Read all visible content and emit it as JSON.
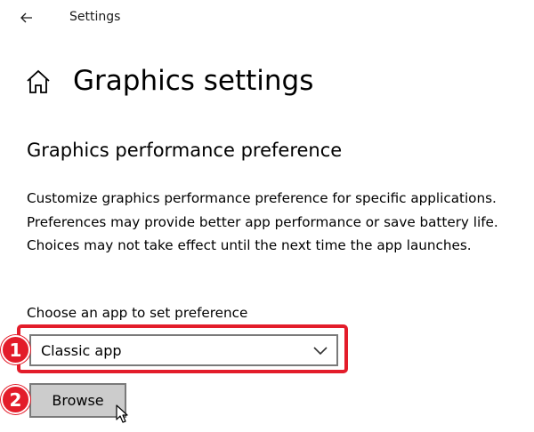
{
  "window": {
    "title": "Settings"
  },
  "header": {
    "title": "Graphics settings"
  },
  "section": {
    "title": "Graphics performance preference",
    "description": "Customize graphics performance preference for specific applications. Preferences may provide better app performance or save battery life. Choices may not take effect until the next time the app launches."
  },
  "app_picker": {
    "label": "Choose an app to set preference",
    "selected": "Classic app",
    "browse_label": "Browse"
  },
  "annotations": {
    "step1": "1",
    "step2": "2",
    "highlight_color": "#e31c2a"
  },
  "icons": {
    "back": "back-arrow-icon",
    "home": "home-icon",
    "dropdown": "chevron-down-icon",
    "cursor": "cursor-pointer-icon"
  }
}
